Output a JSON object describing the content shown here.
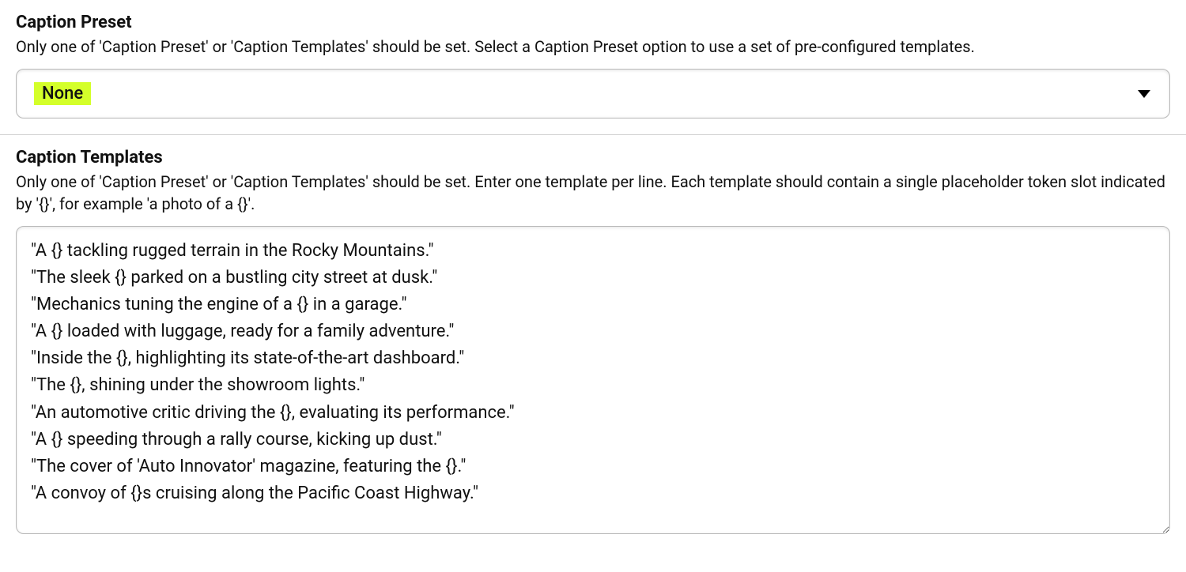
{
  "preset": {
    "title": "Caption Preset",
    "description": "Only one of 'Caption Preset' or 'Caption Templates' should be set. Select a Caption Preset option to use a set of pre-configured templates.",
    "selected": "None"
  },
  "templates": {
    "title": "Caption Templates",
    "description": "Only one of 'Caption Preset' or 'Caption Templates' should be set. Enter one template per line. Each template should contain a single placeholder token slot indicated by '{}', for example 'a photo of a {}'.",
    "value": "\"A {} tackling rugged terrain in the Rocky Mountains.\"\n\"The sleek {} parked on a bustling city street at dusk.\"\n\"Mechanics tuning the engine of a {} in a garage.\"\n\"A {} loaded with luggage, ready for a family adventure.\"\n\"Inside the {}, highlighting its state-of-the-art dashboard.\"\n\"The {}, shining under the showroom lights.\"\n\"An automotive critic driving the {}, evaluating its performance.\"\n\"A {} speeding through a rally course, kicking up dust.\"\n\"The cover of 'Auto Innovator' magazine, featuring the {}.\"\n\"A convoy of {}s cruising along the Pacific Coast Highway.\""
  }
}
